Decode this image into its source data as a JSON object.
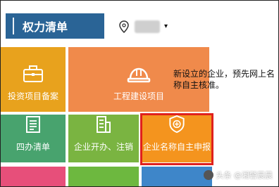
{
  "header": {
    "title": "权力清单",
    "location_caret": "▾"
  },
  "tiles": [
    {
      "label": "投资项目备案",
      "icon": "briefcase-icon",
      "color": "#e8a21d"
    },
    {
      "label": "工程建设项目",
      "icon": "hardhat-icon",
      "color": "#f08a4b"
    },
    {
      "label": "四办清单",
      "icon": "document-list-icon",
      "color": "#48a36e"
    },
    {
      "label": "企业开办、注销",
      "icon": "building-icon",
      "color": "#7ab441"
    },
    {
      "label": "企业名称自主申报",
      "icon": "enterprise-badge-icon",
      "color": "#f4941e"
    },
    {
      "label": "",
      "icon": "",
      "color": "#e74f7a"
    },
    {
      "label": "",
      "icon": "",
      "color": "#6db83f"
    },
    {
      "label": "",
      "icon": "",
      "color": "#3e86c9"
    }
  ],
  "annotation": {
    "text": "新设立的企业，预先网上名称自主核准。"
  },
  "watermark": {
    "text": "头条 @湘警晨晨"
  },
  "colors": {
    "title_bar": "#2a6496",
    "highlight_border": "#e0211d"
  }
}
